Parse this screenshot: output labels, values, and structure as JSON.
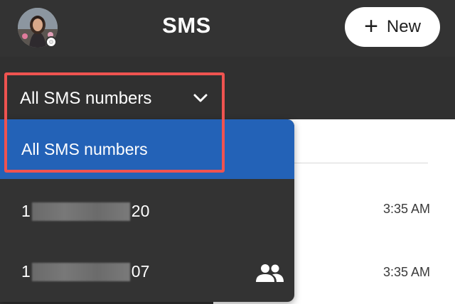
{
  "header": {
    "title": "SMS",
    "new_button_label": "New"
  },
  "selector": {
    "value": "All SMS numbers"
  },
  "dropdown": {
    "options": [
      {
        "label": "All SMS numbers",
        "selected": true
      },
      {
        "prefix": "1",
        "suffix": "20",
        "redacted": true
      },
      {
        "prefix": "1",
        "suffix": "07",
        "redacted": true,
        "icon": "group-icon"
      }
    ]
  },
  "conversations": [
    {
      "time": "3:35 AM"
    },
    {
      "time": "3:35 AM"
    }
  ],
  "colors": {
    "background": "#333333",
    "selected": "#2362b7",
    "highlight": "#ef5350",
    "button": "#ffffff"
  }
}
